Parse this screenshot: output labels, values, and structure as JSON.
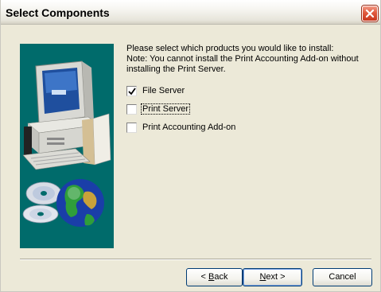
{
  "window": {
    "title": "Select Components"
  },
  "message": {
    "line1": "Please select which products you would like to install:",
    "line2": "Note: You cannot install the Print Accounting Add-on without",
    "line3": "installing the Print Server."
  },
  "options": [
    {
      "label": "File Server",
      "checked": true
    },
    {
      "label": "Print Server",
      "checked": false
    },
    {
      "label": "Print Accounting Add-on",
      "checked": false
    }
  ],
  "buttons": {
    "back": {
      "before": "< ",
      "mnemonic": "B",
      "after": "ack"
    },
    "next": {
      "before": "",
      "mnemonic": "N",
      "after": "ext >"
    },
    "cancel": {
      "label": "Cancel"
    }
  },
  "colors": {
    "art_background": "#006b6b",
    "close_button": "#e0593d",
    "dialog_background": "#ece9d8"
  },
  "icons": {
    "close": "close-icon",
    "checkmark": "checkmark-icon",
    "computer": "computer-icon",
    "globe": "globe-icon",
    "cd": "cd-icon"
  }
}
